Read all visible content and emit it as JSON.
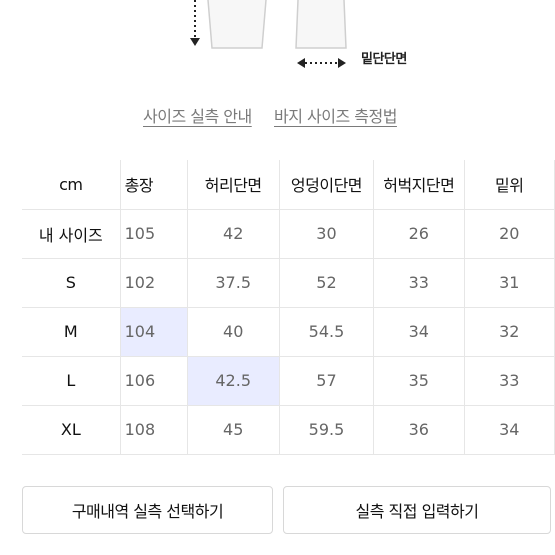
{
  "diagram": {
    "hem_label": "밑단단면"
  },
  "links": {
    "measure_guide": "사이즈 실측 안내",
    "pants_method": "바지 사이즈 측정법"
  },
  "table": {
    "headers": [
      "cm",
      "총장",
      "허리단면",
      "엉덩이단면",
      "허벅지단면",
      "밑위"
    ],
    "rows": [
      {
        "label": "내 사이즈",
        "values": [
          "105",
          "42",
          "30",
          "26",
          "20"
        ]
      },
      {
        "label": "S",
        "values": [
          "102",
          "37.5",
          "52",
          "33",
          "31"
        ]
      },
      {
        "label": "M",
        "values": [
          "104",
          "40",
          "54.5",
          "34",
          "32"
        ]
      },
      {
        "label": "L",
        "values": [
          "106",
          "42.5",
          "57",
          "35",
          "33"
        ]
      },
      {
        "label": "XL",
        "values": [
          "108",
          "45",
          "59.5",
          "36",
          "34"
        ]
      }
    ]
  },
  "buttons": {
    "purchase_history": "구매내역 실측 선택하기",
    "manual_input": "실측 직접 입력하기"
  }
}
